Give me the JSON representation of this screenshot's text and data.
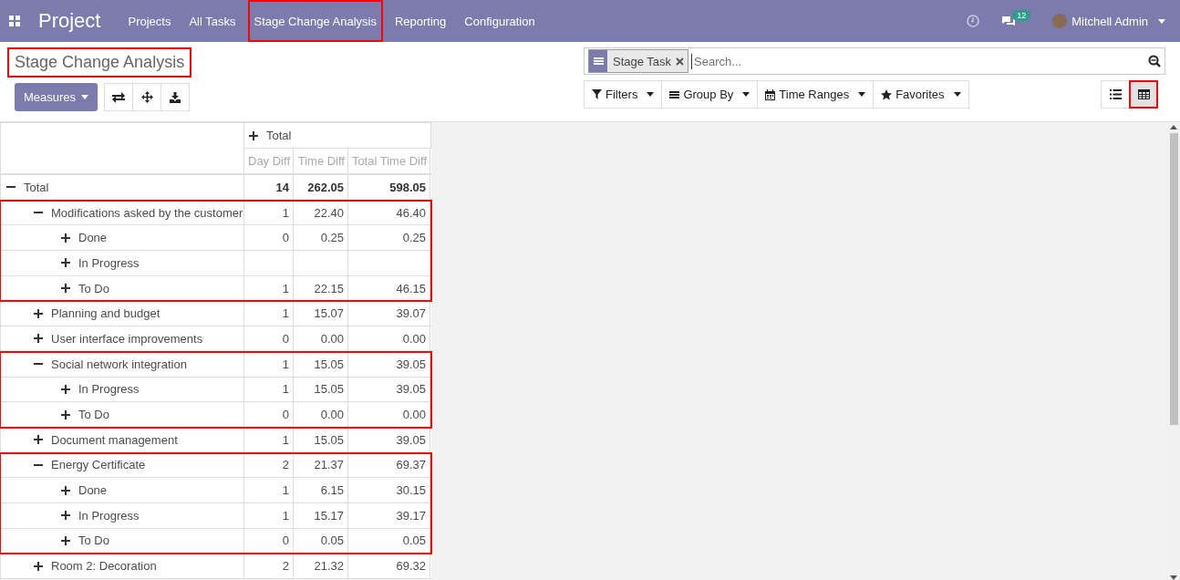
{
  "navbar": {
    "app_name": "Project",
    "menu": [
      {
        "label": "Projects",
        "highlighted": false
      },
      {
        "label": "All Tasks",
        "highlighted": false
      },
      {
        "label": "Stage Change Analysis",
        "highlighted": true
      },
      {
        "label": "Reporting",
        "highlighted": false
      },
      {
        "label": "Configuration",
        "highlighted": false
      }
    ],
    "messages_count": "12",
    "user": "Mitchell Admin"
  },
  "control_panel": {
    "title": "Stage Change Analysis",
    "title_highlighted": true,
    "measures_button": "Measures",
    "search": {
      "facet": "Stage Task",
      "placeholder": "Search..."
    },
    "search_options": [
      {
        "kind": "filter",
        "label": "Filters"
      },
      {
        "kind": "group",
        "label": "Group By"
      },
      {
        "kind": "time",
        "label": "Time Ranges"
      },
      {
        "kind": "favorite",
        "label": "Favorites"
      }
    ],
    "views": [
      {
        "kind": "list",
        "selected": false,
        "highlighted": false
      },
      {
        "kind": "pivot",
        "selected": true,
        "highlighted": true
      }
    ]
  },
  "pivot": {
    "column_header": {
      "label": "Total",
      "expanded": false
    },
    "measures": [
      "Day Diff",
      "Time Diff",
      "Total Time Diff"
    ],
    "rows": [
      {
        "label": "Total",
        "expanded": true,
        "highlighted": false,
        "values": [
          "14",
          "262.05",
          "598.05"
        ],
        "children": [
          {
            "label": "Modifications asked by the customer",
            "expanded": true,
            "highlighted": true,
            "values": [
              "1",
              "22.40",
              "46.40"
            ],
            "children": [
              {
                "label": "Done",
                "expanded": false,
                "highlighted": false,
                "values": [
                  "0",
                  "0.25",
                  "0.25"
                ]
              },
              {
                "label": "In Progress",
                "expanded": false,
                "highlighted": false
              },
              {
                "label": "To Do",
                "expanded": false,
                "highlighted": false,
                "values": [
                  "1",
                  "22.15",
                  "46.15"
                ]
              }
            ]
          },
          {
            "label": "Planning and budget",
            "expanded": false,
            "highlighted": false,
            "values": [
              "1",
              "15.07",
              "39.07"
            ]
          },
          {
            "label": "User interface improvements",
            "expanded": false,
            "highlighted": false,
            "values": [
              "0",
              "0.00",
              "0.00"
            ]
          },
          {
            "label": "Social network integration",
            "expanded": true,
            "highlighted": true,
            "values": [
              "1",
              "15.05",
              "39.05"
            ],
            "children": [
              {
                "label": "In Progress",
                "expanded": false,
                "highlighted": false,
                "values": [
                  "1",
                  "15.05",
                  "39.05"
                ]
              },
              {
                "label": "To Do",
                "expanded": false,
                "highlighted": false,
                "values": [
                  "0",
                  "0.00",
                  "0.00"
                ]
              }
            ]
          },
          {
            "label": "Document management",
            "expanded": false,
            "highlighted": false,
            "values": [
              "1",
              "15.05",
              "39.05"
            ]
          },
          {
            "label": "Energy Certificate",
            "expanded": true,
            "highlighted": true,
            "values": [
              "2",
              "21.37",
              "69.37"
            ],
            "children": [
              {
                "label": "Done",
                "expanded": false,
                "highlighted": false,
                "values": [
                  "1",
                  "6.15",
                  "30.15"
                ]
              },
              {
                "label": "In Progress",
                "expanded": false,
                "highlighted": false,
                "values": [
                  "1",
                  "15.17",
                  "39.17"
                ]
              },
              {
                "label": "To Do",
                "expanded": false,
                "highlighted": false,
                "values": [
                  "0",
                  "0.05",
                  "0.05"
                ]
              }
            ]
          },
          {
            "label": "Room 2: Decoration",
            "expanded": false,
            "highlighted": false,
            "values": [
              "2",
              "21.32",
              "69.32"
            ]
          }
        ]
      }
    ]
  }
}
